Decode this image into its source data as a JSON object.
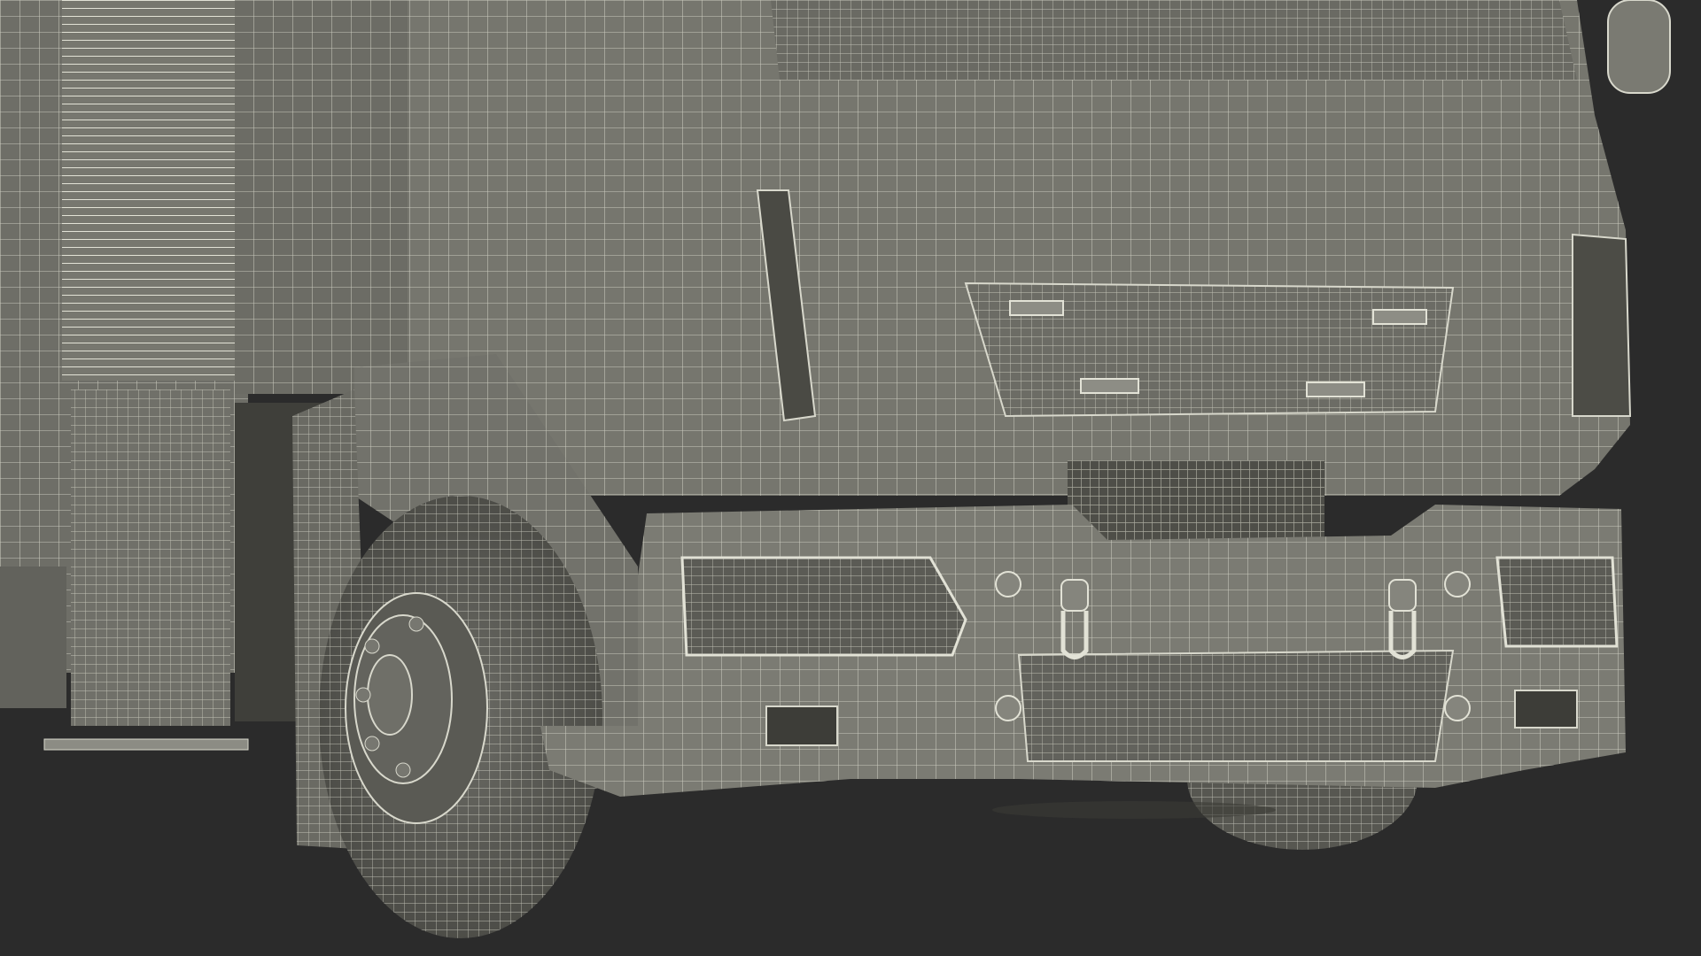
{
  "scene": {
    "subject": "wireframe-truck-cab-front",
    "colors": {
      "background": "#2b2b2b",
      "body": "#75756d",
      "body_dark": "#55554e",
      "body_light": "#8a8a82",
      "wire": "#d8d8cc",
      "tire": "#5c5c56",
      "shadow": "#3a3a36"
    },
    "icons": [
      "truck-cab",
      "wheel",
      "bumper",
      "headlight",
      "tow-hook",
      "grille",
      "side-mirror",
      "storage-shutter"
    ]
  }
}
